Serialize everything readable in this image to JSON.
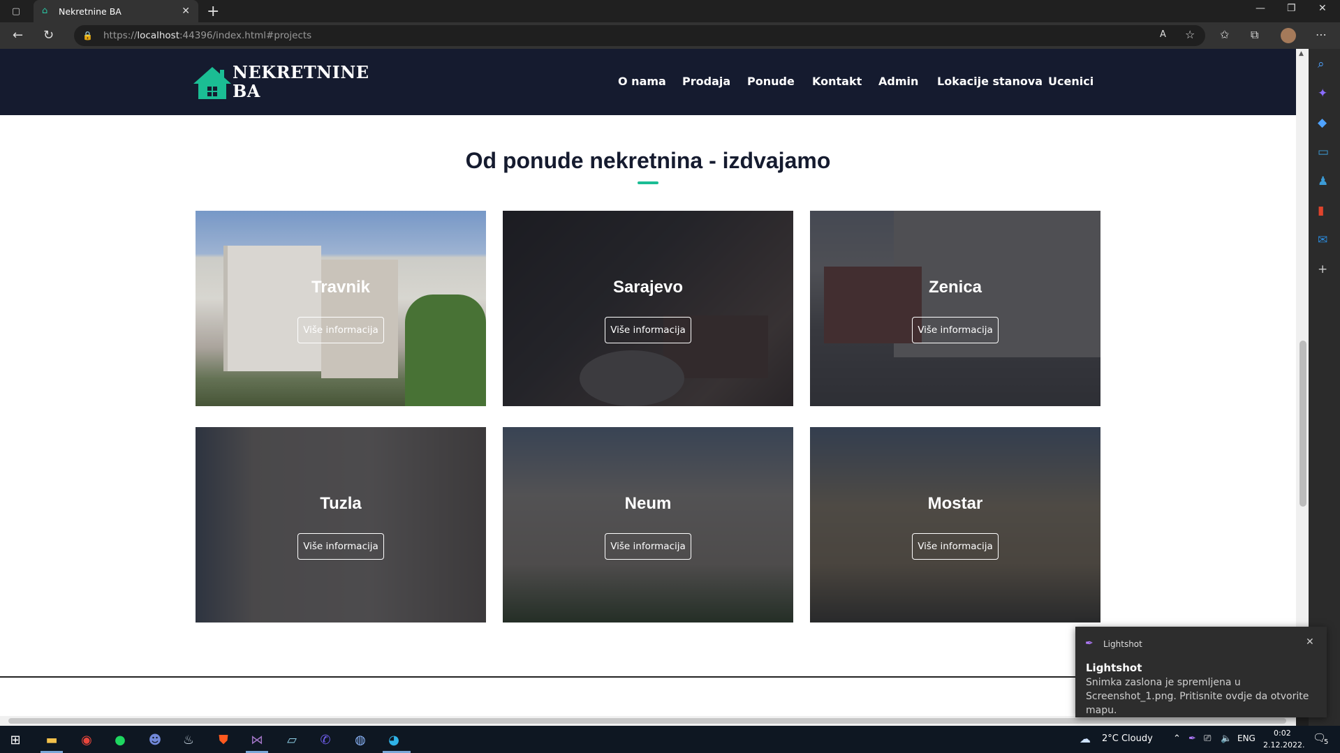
{
  "browser": {
    "tab_title": "Nekretnine BA",
    "url_prefix": "https://",
    "url_host": "localhost",
    "url_rest": ":44396/index.html#projects"
  },
  "header": {
    "brand_line1": "NEKRETNINE",
    "brand_line2": "BA",
    "menu": [
      "O nama",
      "Prodaja",
      "Ponude",
      "Kontakt",
      "Admin",
      "Lokacije stanova",
      "Ucenici"
    ]
  },
  "section": {
    "title": "Od ponude nekretnina - izdvajamo",
    "accent_color": "#1bbd94"
  },
  "cards": [
    {
      "city": "Travnik",
      "button": "Više informacija"
    },
    {
      "city": "Sarajevo",
      "button": "Više informacija"
    },
    {
      "city": "Zenica",
      "button": "Više informacija"
    },
    {
      "city": "Tuzla",
      "button": "Više informacija"
    },
    {
      "city": "Neum",
      "button": "Više informacija"
    },
    {
      "city": "Mostar",
      "button": "Više informacija"
    }
  ],
  "toast": {
    "app": "Lightshot",
    "heading": "Lightshot",
    "body": "Snimka zaslona je spremljena u Screenshot_1.png. Pritisnite ovdje da otvorite mapu."
  },
  "taskbar": {
    "weather": "2°C  Cloudy",
    "lang": "ENG",
    "time": "0:02",
    "date": "2.12.2022.",
    "notification_count": "5"
  }
}
